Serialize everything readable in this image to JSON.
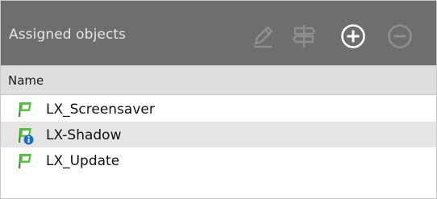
{
  "panel": {
    "title": "Assigned objects",
    "toolbar": [
      {
        "icon": "pencil-icon",
        "enabled": false
      },
      {
        "icon": "signpost-icon",
        "enabled": false
      },
      {
        "icon": "plus-circle-icon",
        "enabled": true
      },
      {
        "icon": "minus-circle-icon",
        "enabled": false
      }
    ]
  },
  "table": {
    "columns": [
      "Name"
    ],
    "rows": [
      {
        "name": "LX_Screensaver",
        "icon": "green-flag-icon",
        "badge": null
      },
      {
        "name": "LX-Shadow",
        "icon": "green-flag-icon",
        "badge": "info-badge-icon"
      },
      {
        "name": "LX_Update",
        "icon": "green-flag-icon",
        "badge": null
      }
    ]
  },
  "colors": {
    "header_bg": "#6e6e6e",
    "flag_green": "#4fae3a",
    "info_blue": "#1f6fc0"
  }
}
